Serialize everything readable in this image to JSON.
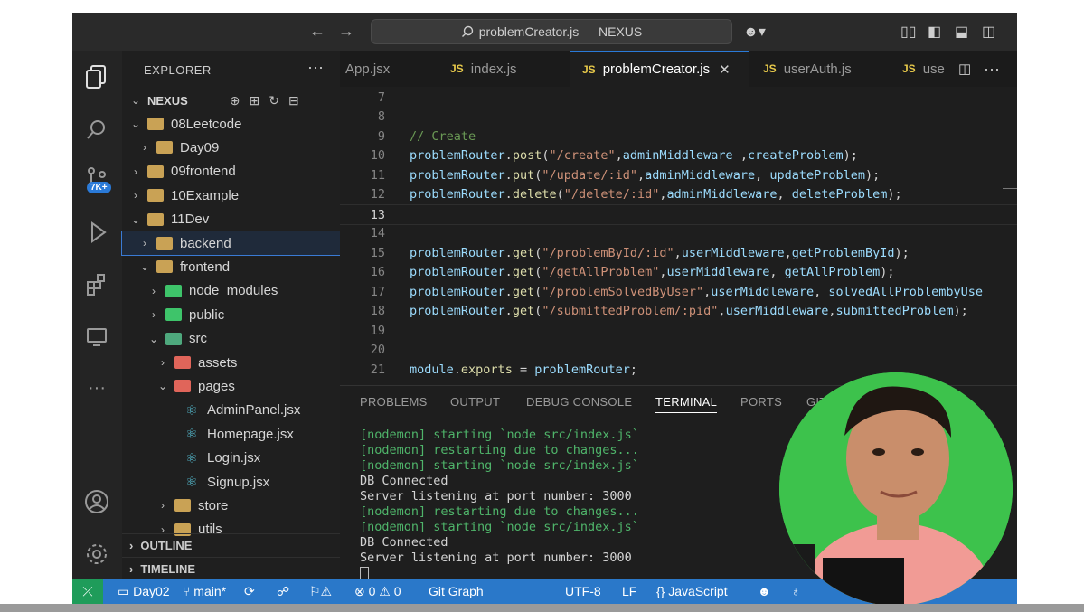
{
  "titlebar": {
    "search_text": "problemCreator.js — NEXUS"
  },
  "activity": {
    "source_control_badge": "7K+"
  },
  "explorer": {
    "header": "EXPLORER",
    "root": "NEXUS",
    "items": [
      {
        "label": "08Leetcode",
        "depth": 1,
        "state": "open",
        "kind": "folder"
      },
      {
        "label": "Day09",
        "depth": 2,
        "state": "closed",
        "kind": "folder"
      },
      {
        "label": "09frontend",
        "depth": 1,
        "state": "closed",
        "kind": "folder"
      },
      {
        "label": "10Example",
        "depth": 1,
        "state": "closed",
        "kind": "folder"
      },
      {
        "label": "11Dev",
        "depth": 1,
        "state": "open",
        "kind": "folder"
      },
      {
        "label": "backend",
        "depth": 2,
        "state": "closed",
        "kind": "folder"
      },
      {
        "label": "frontend",
        "depth": 2,
        "state": "open",
        "kind": "folder"
      },
      {
        "label": "node_modules",
        "depth": 3,
        "state": "closed",
        "kind": "folder-green"
      },
      {
        "label": "public",
        "depth": 3,
        "state": "closed",
        "kind": "folder-green"
      },
      {
        "label": "src",
        "depth": 3,
        "state": "open",
        "kind": "folder-teal"
      },
      {
        "label": "assets",
        "depth": 4,
        "state": "closed",
        "kind": "folder-red"
      },
      {
        "label": "pages",
        "depth": 4,
        "state": "open",
        "kind": "folder-red"
      },
      {
        "label": "AdminPanel.jsx",
        "depth": 5,
        "state": "file",
        "kind": "react"
      },
      {
        "label": "Homepage.jsx",
        "depth": 5,
        "state": "file",
        "kind": "react"
      },
      {
        "label": "Login.jsx",
        "depth": 5,
        "state": "file",
        "kind": "react"
      },
      {
        "label": "Signup.jsx",
        "depth": 5,
        "state": "file",
        "kind": "react"
      },
      {
        "label": "store",
        "depth": 4,
        "state": "closed",
        "kind": "folder"
      },
      {
        "label": "utils",
        "depth": 4,
        "state": "closed",
        "kind": "folder"
      }
    ],
    "outline": "OUTLINE",
    "timeline": "TIMELINE"
  },
  "tabs": [
    {
      "label": "App.jsx",
      "js": ""
    },
    {
      "label": "index.js",
      "js": "JS"
    },
    {
      "label": "problemCreator.js",
      "js": "JS",
      "active": true
    },
    {
      "label": "userAuth.js",
      "js": "JS"
    },
    {
      "label": "use",
      "js": "JS"
    }
  ],
  "editor": {
    "lines": [
      {
        "n": "7",
        "code": ""
      },
      {
        "n": "8",
        "code": ""
      },
      {
        "n": "9",
        "code": "// Create"
      },
      {
        "n": "10",
        "code": "problemRouter.post(\"/create\",adminMiddleware ,createProblem);"
      },
      {
        "n": "11",
        "code": "problemRouter.put(\"/update/:id\",adminMiddleware, updateProblem);"
      },
      {
        "n": "12",
        "code": "problemRouter.delete(\"/delete/:id\",adminMiddleware, deleteProblem);"
      },
      {
        "n": "13",
        "code": ""
      },
      {
        "n": "14",
        "code": ""
      },
      {
        "n": "15",
        "code": "problemRouter.get(\"/problemById/:id\",userMiddleware,getProblemById);"
      },
      {
        "n": "16",
        "code": "problemRouter.get(\"/getAllProblem\",userMiddleware, getAllProblem);"
      },
      {
        "n": "17",
        "code": "problemRouter.get(\"/problemSolvedByUser\",userMiddleware, solvedAllProblembyUse"
      },
      {
        "n": "18",
        "code": "problemRouter.get(\"/submittedProblem/:pid\",userMiddleware,submittedProblem);"
      },
      {
        "n": "19",
        "code": ""
      },
      {
        "n": "20",
        "code": ""
      },
      {
        "n": "21",
        "code": "module.exports = problemRouter;"
      }
    ]
  },
  "panel": {
    "tabs": [
      "PROBLEMS",
      "OUTPUT",
      "DEBUG CONSOLE",
      "TERMINAL",
      "PORTS",
      "GITL"
    ],
    "active_tab": "TERMINAL",
    "terminal": [
      {
        "text": "[nodemon] starting `node src/index.js`",
        "color": "green"
      },
      {
        "text": "[nodemon] restarting due to changes...",
        "color": "green"
      },
      {
        "text": "[nodemon] starting `node src/index.js`",
        "color": "green"
      },
      {
        "text": "DB Connected",
        "color": "white"
      },
      {
        "text": "Server listening at port number: 3000",
        "color": "white"
      },
      {
        "text": "[nodemon] restarting due to changes...",
        "color": "green"
      },
      {
        "text": "[nodemon] starting `node src/index.js`",
        "color": "green"
      },
      {
        "text": "DB Connected",
        "color": "white"
      },
      {
        "text": "Server listening at port number: 3000",
        "color": "white"
      }
    ]
  },
  "status": {
    "workspace": "Day02",
    "branch": "main*",
    "errors": "0",
    "warnings": "0",
    "git_graph": "Git Graph",
    "encoding": "UTF-8",
    "eol": "LF",
    "language": "JavaScript"
  },
  "colors": {
    "status_bar": "#2a78c9",
    "remote": "#1f9c5a",
    "accent": "#2a7ad8",
    "terminal_green": "#4fb46a"
  }
}
